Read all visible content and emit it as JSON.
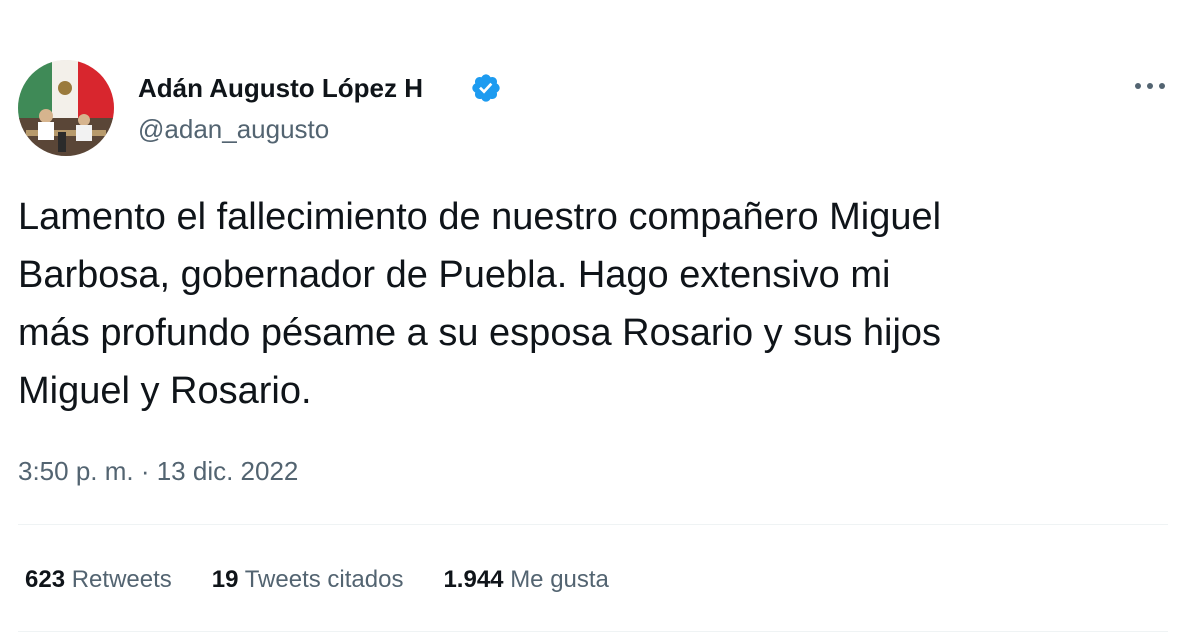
{
  "author": {
    "display_name": "Adán Augusto López H",
    "username": "@adan_augusto",
    "verified": true,
    "avatar_icon": "profile-photo",
    "verified_icon": "verified-badge-icon",
    "accent_color": "#1d9bf0"
  },
  "menu": {
    "icon": "more-options-icon"
  },
  "tweet": {
    "text_lines": [
      "Lamento el fallecimiento de nuestro compañero Miguel",
      "Barbosa, gobernador de Puebla. Hago extensivo mi",
      "más profundo pésame a su esposa Rosario y sus hijos",
      "Miguel y Rosario."
    ],
    "timestamp": "3:50 p. m. · 13 dic. 2022"
  },
  "stats": {
    "retweets_count": "623",
    "retweets_label": "Retweets",
    "quotes_count": "19",
    "quotes_label": "Tweets citados",
    "likes_count": "1.944",
    "likes_label": "Me gusta"
  }
}
